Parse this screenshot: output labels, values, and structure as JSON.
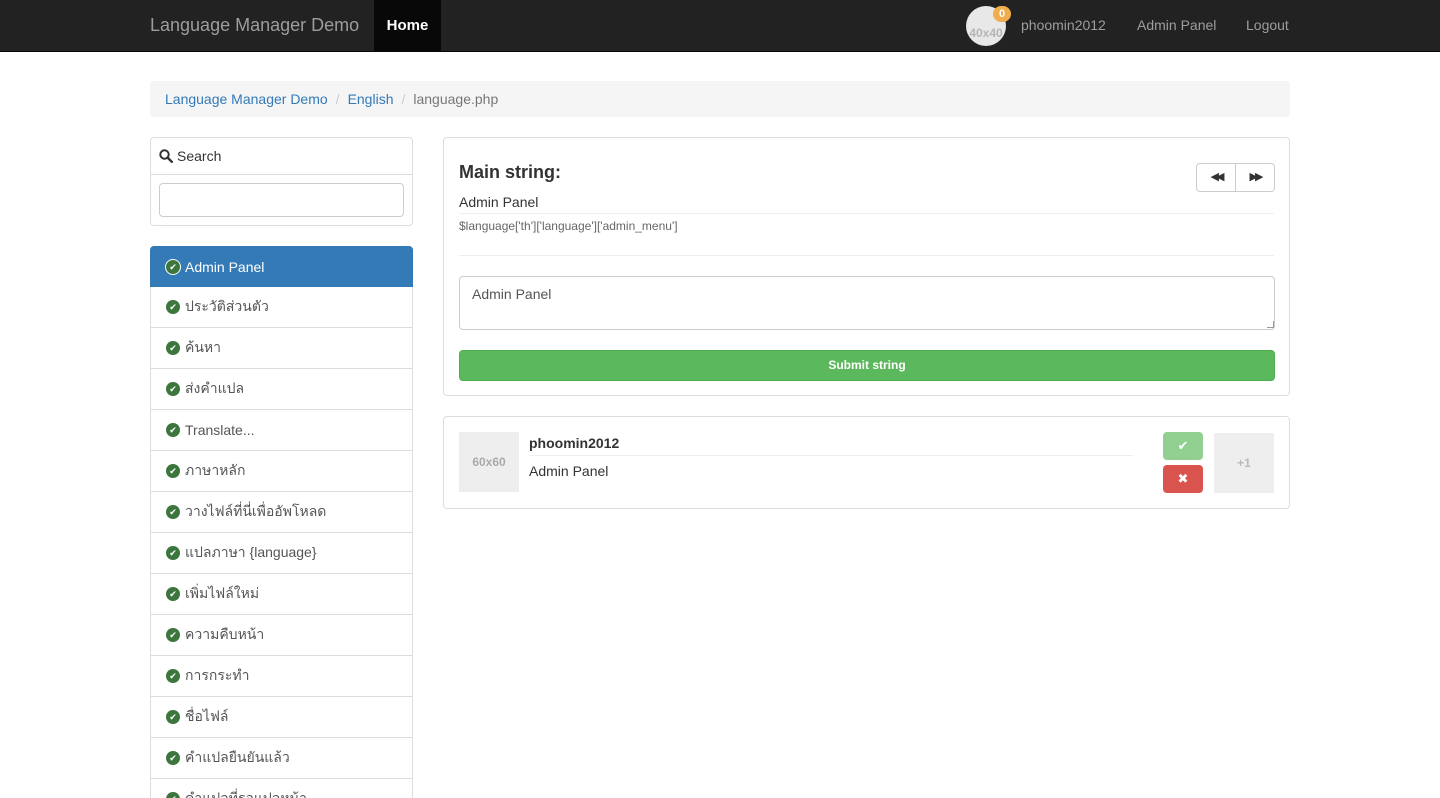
{
  "navbar": {
    "brand": "Language Manager Demo",
    "home": "Home",
    "avatar_placeholder": "40x40",
    "notification_count": "0",
    "username": "phoomin2012",
    "admin_panel": "Admin Panel",
    "logout": "Logout"
  },
  "breadcrumb": {
    "items": [
      "Language Manager Demo",
      "English"
    ],
    "current": "language.php"
  },
  "sidebar": {
    "search_title": "Search",
    "search_value": "",
    "items": [
      {
        "label": "Admin Panel"
      },
      {
        "label": "ประวัติส่วนตัว"
      },
      {
        "label": "ค้นหา"
      },
      {
        "label": "ส่งคำแปล"
      },
      {
        "label": "Translate..."
      },
      {
        "label": "ภาษาหลัก"
      },
      {
        "label": "วางไฟล์ที่นี่เพื่ออัพโหลด"
      },
      {
        "label": "แปลภาษา {language}"
      },
      {
        "label": "เพิ่มไฟล์ใหม่"
      },
      {
        "label": "ความคืบหน้า"
      },
      {
        "label": "การกระทำ"
      },
      {
        "label": "ชื่อไฟล์"
      },
      {
        "label": "คำแปลยืนยันแล้ว"
      },
      {
        "label": "คำแปลที่รอแปลหน้า"
      }
    ]
  },
  "main": {
    "title": "Main string:",
    "string": "Admin Panel",
    "key": "$language['th']['language']['admin_menu']",
    "translation_value": "Admin Panel",
    "submit_label": "Submit string"
  },
  "suggestion": {
    "avatar_placeholder": "60x60",
    "username": "phoomin2012",
    "text": "Admin Panel",
    "vote_label": "+1"
  },
  "colors": {
    "navbar_bg": "#222222",
    "active_item": "#337ab7",
    "success": "#5cb85c",
    "danger": "#d9534f",
    "check_icon": "#3c763d"
  }
}
